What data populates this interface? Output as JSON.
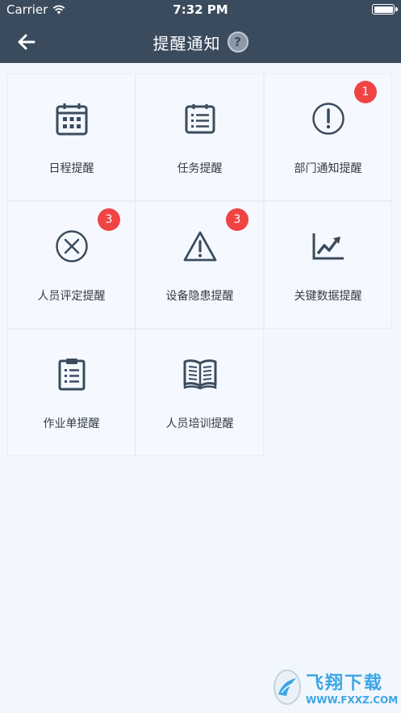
{
  "status_bar": {
    "carrier": "Carrier",
    "time": "7:32 PM",
    "battery_level": 1.0
  },
  "nav": {
    "title": "提醒通知",
    "help_label": "?"
  },
  "tiles": [
    {
      "label": "日程提醒",
      "icon": "calendar-icon",
      "badge": ""
    },
    {
      "label": "任务提醒",
      "icon": "task-list-icon",
      "badge": ""
    },
    {
      "label": "部门通知提醒",
      "icon": "exclamation-circle-icon",
      "badge": "1"
    },
    {
      "label": "人员评定提醒",
      "icon": "close-circle-icon",
      "badge": "3"
    },
    {
      "label": "设备隐患提醒",
      "icon": "warning-triangle-icon",
      "badge": "3"
    },
    {
      "label": "关键数据提醒",
      "icon": "trend-chart-icon",
      "badge": ""
    },
    {
      "label": "作业单提醒",
      "icon": "clipboard-icon",
      "badge": ""
    },
    {
      "label": "人员培训提醒",
      "icon": "open-book-icon",
      "badge": ""
    }
  ],
  "watermark": {
    "title": "飞翔下载",
    "url": "WWW.FXXZ.COM"
  },
  "colors": {
    "navbar": "#3b4b5e",
    "background": "#f2f7fd",
    "badge": "#f04444",
    "icon": "#3b4b5e"
  }
}
